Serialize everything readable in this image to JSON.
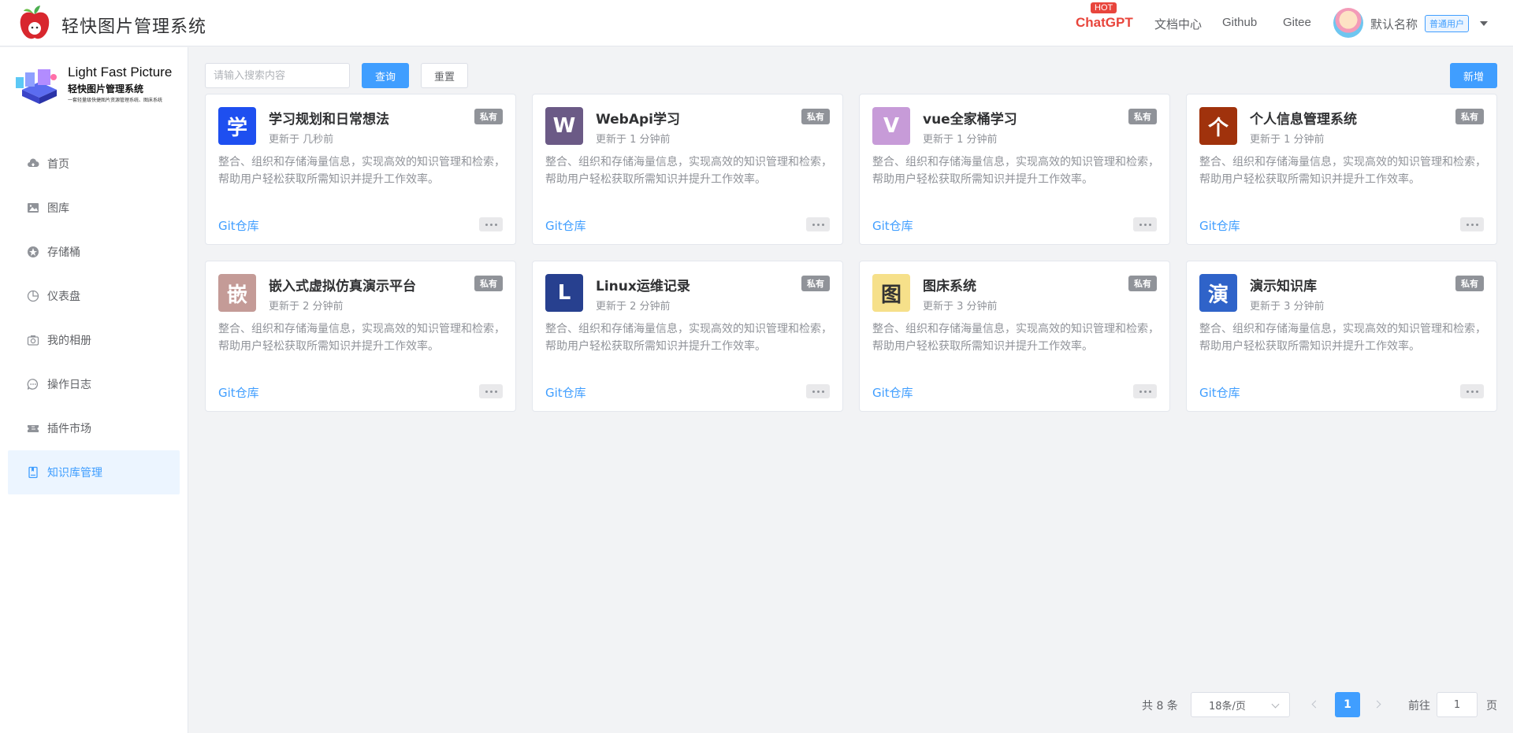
{
  "header": {
    "app_title": "轻快图片管理系统",
    "nav": {
      "chatgpt": "ChatGPT",
      "hot": "HOT",
      "docs": "文档中心",
      "github": "Github",
      "gitee": "Gitee"
    },
    "user": {
      "name": "默认名称",
      "role": "普通用户"
    }
  },
  "sidebar": {
    "brand": {
      "name_en": "Light Fast Picture",
      "name_cn": "轻快图片管理系统",
      "tagline": "一套轻量级快捷图片资源管理系统、图床系统"
    },
    "items": [
      {
        "label": "首页",
        "icon": "cloud-upload-icon",
        "active": false
      },
      {
        "label": "图库",
        "icon": "image-icon",
        "active": false
      },
      {
        "label": "存储桶",
        "icon": "bucket-icon",
        "active": false
      },
      {
        "label": "仪表盘",
        "icon": "pie-chart-icon",
        "active": false
      },
      {
        "label": "我的相册",
        "icon": "camera-icon",
        "active": false
      },
      {
        "label": "操作日志",
        "icon": "chat-dots-icon",
        "active": false
      },
      {
        "label": "插件市场",
        "icon": "ticket-icon",
        "active": false
      },
      {
        "label": "知识库管理",
        "icon": "notebook-icon",
        "active": true
      }
    ]
  },
  "toolbar": {
    "search_placeholder": "请输入搜索内容",
    "query_label": "查询",
    "reset_label": "重置",
    "add_label": "新增"
  },
  "cards": [
    {
      "icon_char": "学",
      "icon_color": "#1e4ff0",
      "title": "学习规划和日常想法",
      "updated": "更新于 几秒前",
      "badge": "私有",
      "desc": "整合、组织和存储海量信息，实现高效的知识管理和检索，帮助用户轻松获取所需知识并提升工作效率。",
      "link": "Git仓库"
    },
    {
      "icon_char": "W",
      "icon_color": "#6b5a86",
      "title": "WebApi学习",
      "updated": "更新于 1 分钟前",
      "badge": "私有",
      "desc": "整合、组织和存储海量信息，实现高效的知识管理和检索，帮助用户轻松获取所需知识并提升工作效率。",
      "link": "Git仓库"
    },
    {
      "icon_char": "V",
      "icon_color": "#c79bd8",
      "title": "vue全家桶学习",
      "updated": "更新于 1 分钟前",
      "badge": "私有",
      "desc": "整合、组织和存储海量信息，实现高效的知识管理和检索，帮助用户轻松获取所需知识并提升工作效率。",
      "link": "Git仓库"
    },
    {
      "icon_char": "个",
      "icon_color": "#a0320c",
      "title": "个人信息管理系统",
      "updated": "更新于 1 分钟前",
      "badge": "私有",
      "desc": "整合、组织和存储海量信息，实现高效的知识管理和检索，帮助用户轻松获取所需知识并提升工作效率。",
      "link": "Git仓库"
    },
    {
      "icon_char": "嵌",
      "icon_color": "#c49b97",
      "title": "嵌入式虚拟仿真演示平台",
      "updated": "更新于 2 分钟前",
      "badge": "私有",
      "desc": "整合、组织和存储海量信息，实现高效的知识管理和检索，帮助用户轻松获取所需知识并提升工作效率。",
      "link": "Git仓库"
    },
    {
      "icon_char": "L",
      "icon_color": "#27408f",
      "title": "Linux运维记录",
      "updated": "更新于 2 分钟前",
      "badge": "私有",
      "desc": "整合、组织和存储海量信息，实现高效的知识管理和检索，帮助用户轻松获取所需知识并提升工作效率。",
      "link": "Git仓库"
    },
    {
      "icon_char": "图",
      "icon_color": "#f6e08a",
      "title": "图床系统",
      "updated": "更新于 3 分钟前",
      "badge": "私有",
      "desc": "整合、组织和存储海量信息，实现高效的知识管理和检索，帮助用户轻松获取所需知识并提升工作效率。",
      "link": "Git仓库"
    },
    {
      "icon_char": "演",
      "icon_color": "#2f63c9",
      "title": "演示知识库",
      "updated": "更新于 3 分钟前",
      "badge": "私有",
      "desc": "整合、组织和存储海量信息，实现高效的知识管理和检索，帮助用户轻松获取所需知识并提升工作效率。",
      "link": "Git仓库"
    }
  ],
  "pagination": {
    "total": "共 8 条",
    "page_size": "18条/页",
    "current_page": "1",
    "goto_label": "前往",
    "goto_value": "1",
    "page_label": "页"
  },
  "colors": {
    "primary": "#409eff",
    "hot": "#e8453c",
    "badge": "#909399"
  }
}
